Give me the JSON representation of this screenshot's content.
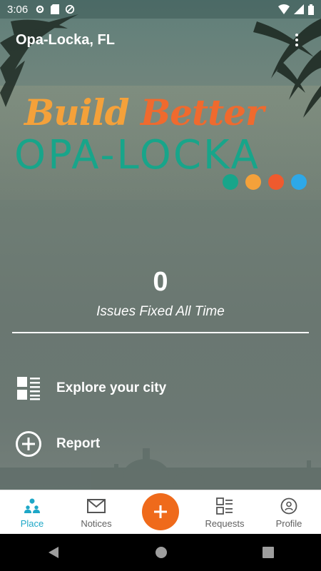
{
  "status_bar": {
    "time": "3:06"
  },
  "app_bar": {
    "title": "Opa-Locka, FL"
  },
  "logo": {
    "line1_word1": "Build",
    "line1_word2": "Better",
    "line2": "OPA-LOCKA",
    "dot_colors": [
      "#18a58a",
      "#f4a13a",
      "#ef5a2e",
      "#2ea8e8"
    ]
  },
  "stats": {
    "value": "0",
    "label": "Issues Fixed All Time"
  },
  "menu": {
    "explore_label": "Explore your city",
    "report_label": "Report"
  },
  "bottom_nav": {
    "items": [
      {
        "label": "Place",
        "icon": "place-people-icon",
        "active": true
      },
      {
        "label": "Notices",
        "icon": "envelope-icon",
        "active": false
      },
      {
        "label": "Requests",
        "icon": "requests-list-icon",
        "active": false
      },
      {
        "label": "Profile",
        "icon": "profile-icon",
        "active": false
      }
    ],
    "fab_icon": "plus-icon"
  },
  "colors": {
    "accent": "#1ea7c7",
    "fab": "#ef6a1b",
    "logo_orange": "#f4a13a",
    "logo_red_orange": "#ef6a2e",
    "logo_teal": "#18a58a"
  }
}
